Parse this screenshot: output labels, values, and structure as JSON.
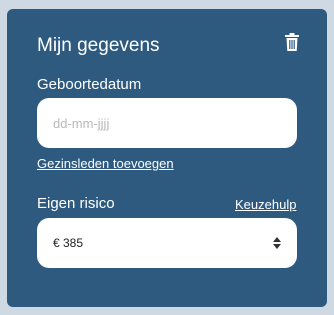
{
  "card": {
    "title": "Mijn gegevens",
    "delete_icon": "trash-icon"
  },
  "birthdate": {
    "label": "Geboortedatum",
    "value": "",
    "placeholder": "dd-mm-jjjj"
  },
  "add_family_link": "Gezinsleden toevoegen",
  "deductible": {
    "label": "Eigen risico",
    "help_link": "Keuzehulp",
    "selected": "€ 385",
    "icon": "sort-arrows-icon"
  },
  "colors": {
    "card_background": "#2e5a80",
    "page_background": "#cfd9e3",
    "text": "#ffffff"
  }
}
